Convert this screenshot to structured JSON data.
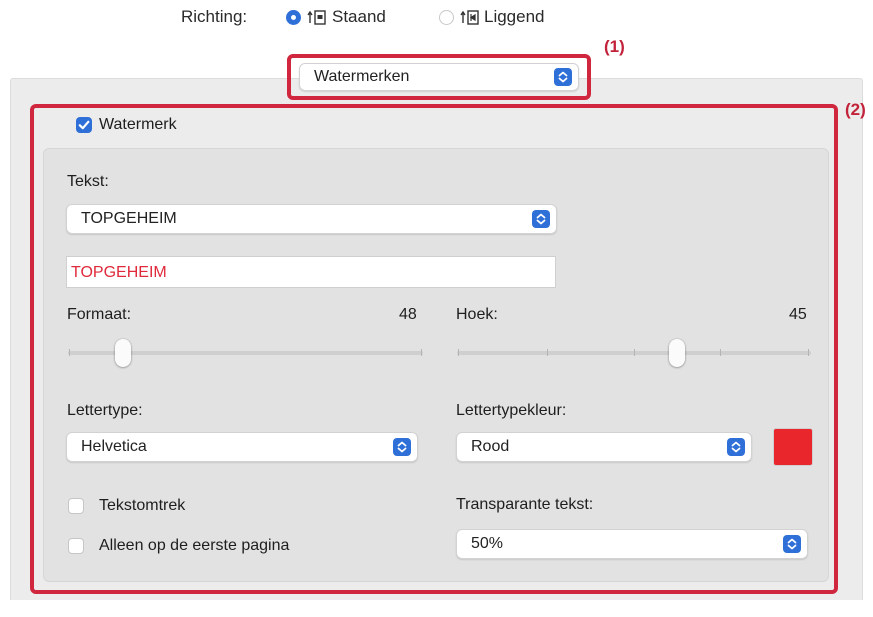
{
  "orientation": {
    "label": "Richting:",
    "options": [
      {
        "label": "Staand",
        "selected": true
      },
      {
        "label": "Liggend",
        "selected": false
      }
    ]
  },
  "section_select": {
    "value": "Watermerken"
  },
  "annotations": {
    "one": "(1)",
    "two": "(2)"
  },
  "watermark": {
    "checkbox_label": "Watermerk",
    "checked": true,
    "text_label": "Tekst:",
    "text_select": "TOPGEHEIM",
    "text_value": "TOPGEHEIM",
    "size_label": "Formaat:",
    "size_value": "48",
    "angle_label": "Hoek:",
    "angle_value": "45",
    "font_label": "Lettertype:",
    "font_value": "Helvetica",
    "color_label": "Lettertypekleur:",
    "color_value": "Rood",
    "color_hex": "#e8262c",
    "outline_label": "Tekstomtrek",
    "first_page_label": "Alleen op de eerste pagina",
    "transparency_label": "Transparante tekst:",
    "transparency_value": "50%"
  },
  "colors": {
    "accent": "#2f6fd8",
    "annotation": "#d0273e",
    "preview_text": "#e0293b"
  }
}
